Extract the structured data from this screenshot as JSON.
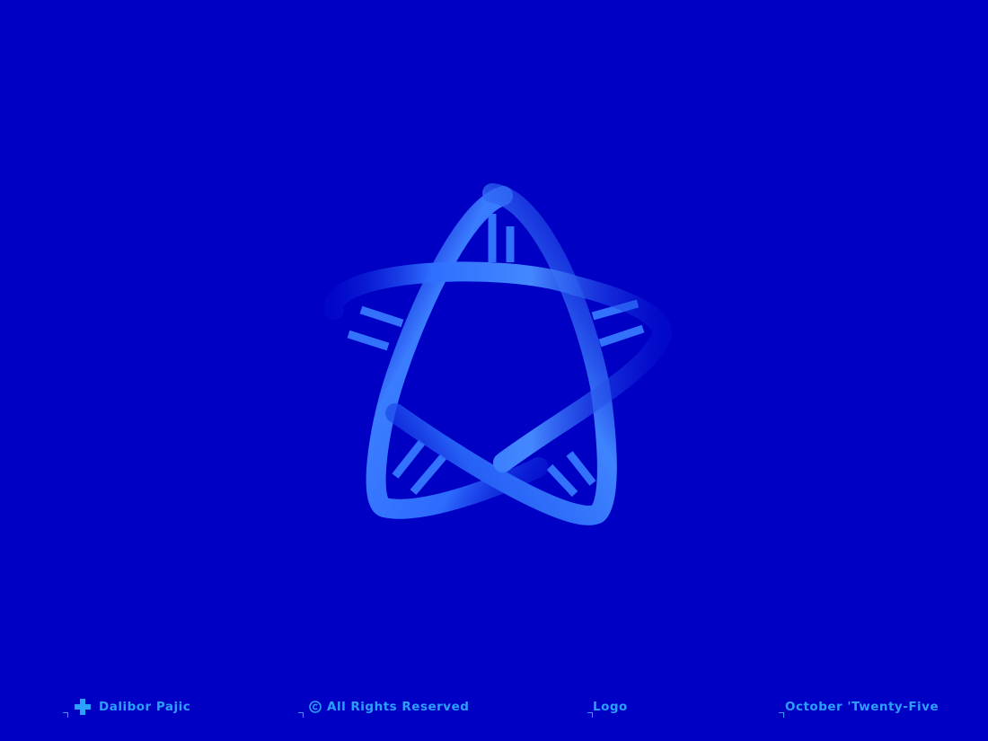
{
  "colors": {
    "background": "#0000c4",
    "accent": "#2aa0ff",
    "ribbon_light": "#3a7bff",
    "ribbon_dark": "#0a24e0"
  },
  "artwork": {
    "icon": "star-ribbon-logo"
  },
  "footer": {
    "author": "Dalibor Pajic",
    "author_icon": "plus-cross-icon",
    "rights": "All Rights Reserved",
    "rights_icon": "copyright-icon",
    "category": "Logo",
    "date": "October 'Twenty-Five"
  }
}
